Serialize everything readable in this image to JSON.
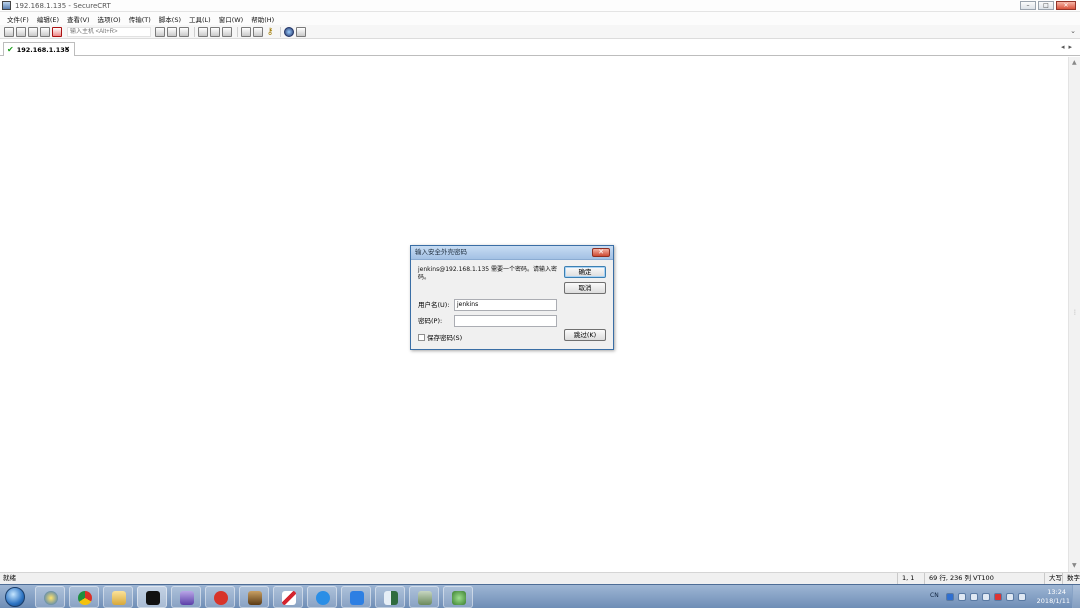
{
  "window": {
    "title": "192.168.1.135 - SecureCRT",
    "minimize": "–",
    "maximize": "□",
    "close": "✕"
  },
  "menubar": {
    "items": [
      "文件(F)",
      "编辑(E)",
      "查看(V)",
      "选项(O)",
      "传输(T)",
      "脚本(S)",
      "工具(L)",
      "窗口(W)",
      "帮助(H)"
    ]
  },
  "toolbar": {
    "host_placeholder": "输入主机 <Alt+R>"
  },
  "tabs": [
    {
      "label": "192.168.1.135",
      "status_icon": "check-icon",
      "close": "×"
    }
  ],
  "dialog": {
    "title": "输入安全外壳密码",
    "message": "jenkins@192.168.1.135 需要一个密码。请输入密码。",
    "username_label": "用户名(U):",
    "username_value": "jenkins",
    "password_label": "密码(P):",
    "password_value": "",
    "save_password_label": "保存密码(S)",
    "ok_button": "确定",
    "cancel_button": "取消",
    "skip_button": "跳过(K)"
  },
  "statusbar": {
    "ready": "就绪",
    "cursor": "1,  1",
    "size": "69 行, 236 列 VT100",
    "caps": "大写",
    "num": "数字"
  },
  "taskbar": {
    "lang": "CN",
    "time": "13:24",
    "date": "2018/1/11",
    "colors": {
      "bar": "#6e8db6",
      "accent": "#2d74c4"
    }
  }
}
